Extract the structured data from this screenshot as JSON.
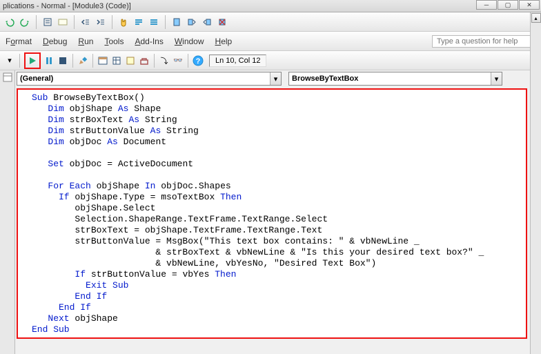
{
  "title": "plications - Normal - [Module3 (Code)]",
  "menubar": {
    "format": "Format",
    "debug": "Debug",
    "run": "Run",
    "tools": "Tools",
    "addins": "Add-Ins",
    "window": "Window",
    "help": "Help"
  },
  "helpPlaceholder": "Type a question for help",
  "cursorPos": "Ln 10, Col 12",
  "dropdowns": {
    "left": "(General)",
    "right": "BrowseByTextBox"
  },
  "code": {
    "l1a": "Sub",
    "l1b": " BrowseByTextBox()",
    "l2a": "   Dim",
    "l2b": " objShape ",
    "l2c": "As",
    "l2d": " Shape",
    "l3a": "   Dim",
    "l3b": " strBoxText ",
    "l3c": "As",
    "l3d": " String",
    "l4a": "   Dim",
    "l4b": " strButtonValue ",
    "l4c": "As",
    "l4d": " String",
    "l5a": "   Dim",
    "l5b": " objDoc ",
    "l5c": "As",
    "l5d": " Document",
    "l6": "",
    "l7a": "   Set",
    "l7b": " objDoc = ActiveDocument",
    "l8": "",
    "l9a": "   For Each",
    "l9b": " objShape ",
    "l9c": "In",
    "l9d": " objDoc.Shapes",
    "l10a": "     If ",
    "l10b": "objShape.Type = msoTextBox ",
    "l10c": "Then",
    "l11": "        objShape.Select",
    "l12": "        Selection.ShapeRange.TextFrame.TextRange.Select",
    "l13": "        strBoxText = objShape.TextFrame.TextRange.Text",
    "l14": "        strButtonValue = MsgBox(\"This text box contains: \" & vbNewLine _",
    "l15": "                       & strBoxText & vbNewLine & \"Is this your desired text box?\" _",
    "l16": "                       & vbNewLine, vbYesNo, \"Desired Text Box\")",
    "l17a": "        If",
    "l17b": " strButtonValue = vbYes ",
    "l17c": "Then",
    "l18a": "          Exit Sub",
    "l19a": "        End If",
    "l20a": "     End If",
    "l21a": "   Next",
    "l21b": " objShape",
    "l22a": "End Sub"
  }
}
